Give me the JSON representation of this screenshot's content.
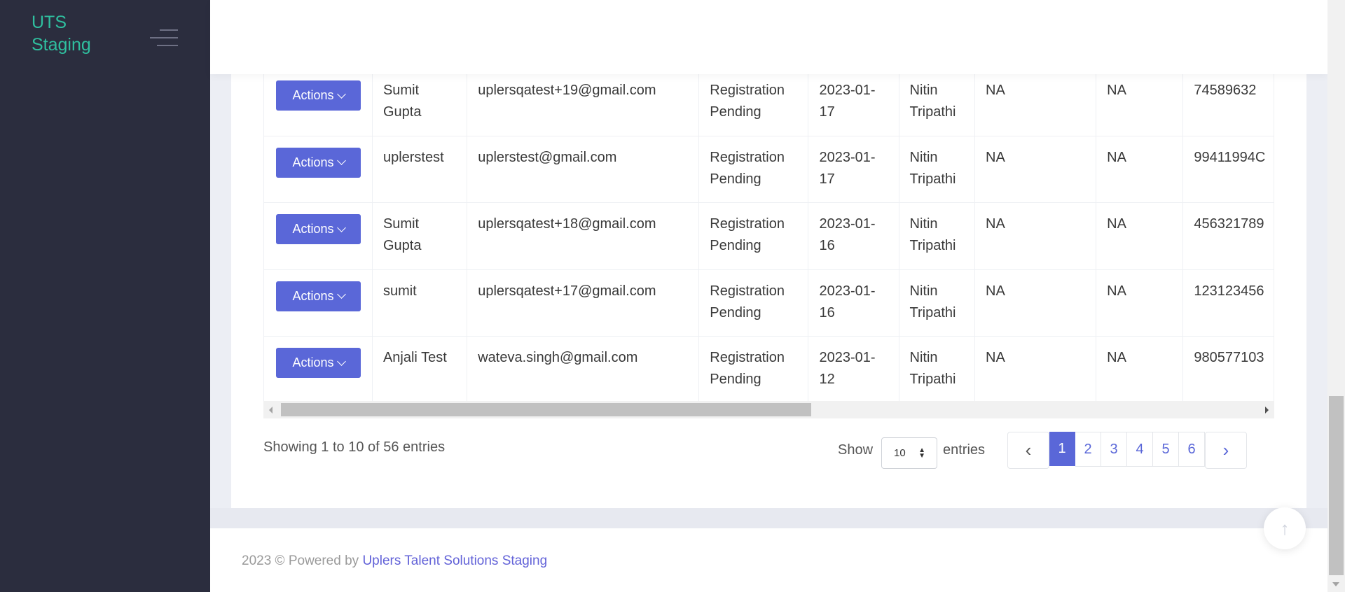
{
  "sidebar": {
    "brand_line1": "UTS",
    "brand_line2": "Staging"
  },
  "table": {
    "rows": [
      {
        "action": "Actions",
        "name": "Sumit Gupta",
        "email": "uplersqatest+19@gmail.com",
        "status": "Registration Pending",
        "date": "2023-01-17",
        "manager": "Nitin Tripathi",
        "col7": "NA",
        "col8": "NA",
        "phone": "74589632"
      },
      {
        "action": "Actions",
        "name": "uplerstest",
        "email": "uplerstest@gmail.com",
        "status": "Registration Pending",
        "date": "2023-01-17",
        "manager": "Nitin Tripathi",
        "col7": "NA",
        "col8": "NA",
        "phone": "99411994C"
      },
      {
        "action": "Actions",
        "name": "Sumit Gupta",
        "email": "uplersqatest+18@gmail.com",
        "status": "Registration Pending",
        "date": "2023-01-16",
        "manager": "Nitin Tripathi",
        "col7": "NA",
        "col8": "NA",
        "phone": "456321789"
      },
      {
        "action": "Actions",
        "name": "sumit",
        "email": "uplersqatest+17@gmail.com",
        "status": "Registration Pending",
        "date": "2023-01-16",
        "manager": "Nitin Tripathi",
        "col7": "NA",
        "col8": "NA",
        "phone": "123123456"
      },
      {
        "action": "Actions",
        "name": "Anjali Test",
        "email": "wateva.singh@gmail.com",
        "status": "Registration Pending",
        "date": "2023-01-12",
        "manager": "Nitin Tripathi",
        "col7": "NA",
        "col8": "NA",
        "phone": "980577103"
      }
    ]
  },
  "info": "Showing 1 to 10 of 56 entries",
  "length": {
    "show": "Show",
    "value": "10",
    "entries": "entries"
  },
  "pager": {
    "prev": "‹",
    "pages": [
      "1",
      "2",
      "3",
      "4",
      "5",
      "6"
    ],
    "current": "1",
    "next": "›"
  },
  "footer": {
    "text": "2023 © Powered by ",
    "link": "Uplers Talent Solutions Staging"
  },
  "totop": "↑",
  "colors": {
    "accent": "#5a67d8",
    "brand": "#2fbf9f",
    "sidebar": "#2b2d3e"
  }
}
